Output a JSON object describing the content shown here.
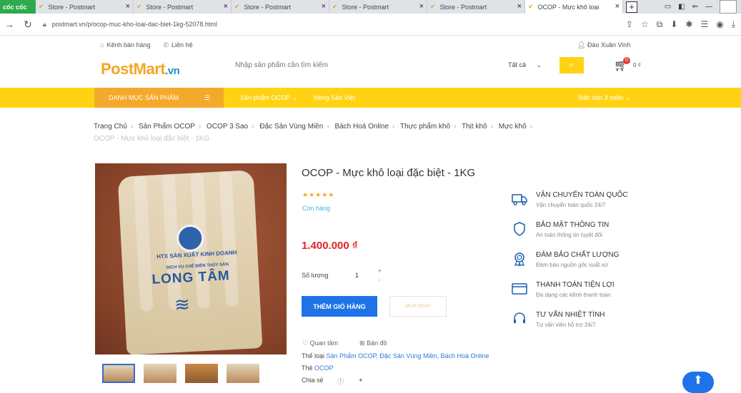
{
  "browser": {
    "brand": "cốc cốc",
    "tabs": [
      {
        "label": "Store - Postmart"
      },
      {
        "label": "Store - Postmart"
      },
      {
        "label": "Store - Postmart"
      },
      {
        "label": "Store - Postmart"
      },
      {
        "label": "Store - Postmart"
      },
      {
        "label": "OCOP - Mực khô loại"
      }
    ],
    "url": "postmart.vn/p/ocop-muc-kho-loai-dac-biet-1kg-52078.html"
  },
  "header": {
    "seller_link": "Kênh bán hàng",
    "contact_link": "Liên hệ",
    "user_name": "Đào Xuân Vinh",
    "logo": "PostMart",
    "logo_suffix": ".vn",
    "search_placeholder": "Nhập sản phẩm cần tìm kiếm",
    "category_select": "Tất cả",
    "cart_count": "0",
    "cart_total": "0 ₫"
  },
  "nav": {
    "menu": "DANH MỤC SẢN PHẨM",
    "item1": "Sản phẩm OCOP",
    "item2": "Nông Sản Việt",
    "item3": "Đặc sản 3 miền"
  },
  "breadcrumb": {
    "items": [
      "Trang Chủ",
      "Sản Phẩm OCOP",
      "OCOP 3 Sao",
      "Đặc Sản Vùng Miền",
      "Bách Hoá Online",
      "Thực phẩm khô",
      "Thịt khô",
      "Mực khô"
    ],
    "current": "OCOP - Mực khô loại đặc biệt - 1KG"
  },
  "product": {
    "title": "OCOP - Mực khô loại đặc biệt - 1KG",
    "rating": 5,
    "stars": "★★★★★",
    "stock": "Còn hàng",
    "price": "1.400.000 ₫",
    "qty_label": "Số lượng",
    "qty": "1",
    "add_to_cart": "THÊM GIỎ HÀNG",
    "buy_now": "MUA NGAY",
    "follow": "Quan tâm",
    "map": "Bản đồ",
    "category_label": "Thể loại",
    "categories": "Sản Phẩm OCOP, Đặc Sản Vùng Miền, Bách Hoá Online",
    "tag_label": "Thẻ",
    "tag": "OCOP",
    "share_label": "Chia sẻ",
    "image_text_1": "HTX SẢN XUẤT KINH DOANH",
    "image_text_2": "DỊCH VỤ CHẾ BIẾN THỦY SẢN",
    "image_text_3": "LONG TÂM"
  },
  "features": [
    {
      "title": "VẬN CHUYỂN TOÀN QUỐC",
      "sub": "Vận chuyển toàn quốc 24/7",
      "icon": "truck-icon"
    },
    {
      "title": "BẢO MẬT THÔNG TIN",
      "sub": "An toàn thông tin tuyệt đối",
      "icon": "shield-icon"
    },
    {
      "title": "ĐẢM BẢO CHẤT LƯỢNG",
      "sub": "Đảm bảo nguồn gốc xuất xứ",
      "icon": "medal-icon"
    },
    {
      "title": "THANH TOÁN TIỆN LỢI",
      "sub": "Đa dạng các kênh thanh toán",
      "icon": "card-icon"
    },
    {
      "title": "TƯ VẤN NHIỆT TÌNH",
      "sub": "Tư vấn viên hỗ trợ 24/7",
      "icon": "headset-icon"
    }
  ],
  "colors": {
    "accent": "#ffd313",
    "menu": "#f5a92a",
    "primary": "#1e73e8",
    "price": "#e0242a"
  }
}
